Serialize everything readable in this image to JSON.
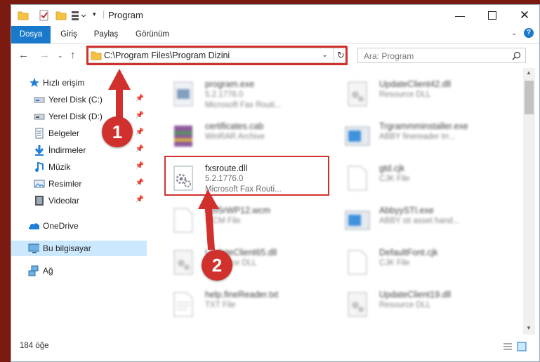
{
  "window": {
    "title": "Program"
  },
  "ribbon": {
    "tabs": [
      {
        "label": "Dosya"
      },
      {
        "label": "Giriş"
      },
      {
        "label": "Paylaş"
      },
      {
        "label": "Görünüm"
      }
    ]
  },
  "address": {
    "path": "C:\\Program Files\\Program Dizini"
  },
  "search": {
    "placeholder": "Ara: Program"
  },
  "nav": {
    "items": [
      {
        "label": "Hızlı erişim",
        "icon": "star-icon"
      },
      {
        "label": "Yerel Disk (C:)",
        "icon": "drive-icon"
      },
      {
        "label": "Yerel Disk (D:)",
        "icon": "drive-icon"
      },
      {
        "label": "Belgeler",
        "icon": "documents-icon"
      },
      {
        "label": "İndirmeler",
        "icon": "download-icon"
      },
      {
        "label": "Müzik",
        "icon": "music-icon"
      },
      {
        "label": "Resimler",
        "icon": "pictures-icon"
      },
      {
        "label": "Videolar",
        "icon": "videos-icon"
      },
      {
        "label": "OneDrive",
        "icon": "cloud-icon"
      },
      {
        "label": "Bu bilgisayar",
        "icon": "computer-icon"
      },
      {
        "label": "Ağ",
        "icon": "network-icon"
      }
    ]
  },
  "files": [
    {
      "name": "program.exe",
      "line2": "5.2.1776.0",
      "line3": "Microsoft Fax Routi..."
    },
    {
      "name": "UpdateClient42.dll",
      "line2": "Resource DLL",
      "line3": ""
    },
    {
      "name": "certificates.cab",
      "line2": "WinRAR Archive",
      "line3": ""
    },
    {
      "name": "Trgrammminstaller.exe",
      "line2": "ABBY finereader trr...",
      "line3": ""
    },
    {
      "name": "fxsroute.dll",
      "line2": "5.2.1776.0",
      "line3": "Microsoft Fax Routi..."
    },
    {
      "name": "gtd.cjk",
      "line2": "CJK File",
      "line3": ""
    },
    {
      "name": "Bef5rWP12.wcm",
      "line2": "WCM File",
      "line3": ""
    },
    {
      "name": "AbbyySTI.exe",
      "line2": "ABBY sti asset hand...",
      "line3": ""
    },
    {
      "name": "UpdateClient65.dll",
      "line2": "Resource DLL",
      "line3": ""
    },
    {
      "name": "DefaultFont.cjk",
      "line2": "CJK File",
      "line3": ""
    },
    {
      "name": "help.fineReader.txt",
      "line2": "TXT File",
      "line3": ""
    },
    {
      "name": "UpdateClient19.dll",
      "line2": "Resource DLL",
      "line3": ""
    }
  ],
  "status": {
    "count": "184 öğe"
  },
  "annotations": {
    "step1": "1",
    "step2": "2"
  },
  "colors": {
    "accent": "#1979ca",
    "highlight": "#d0312d",
    "selected": "#cce8ff"
  }
}
